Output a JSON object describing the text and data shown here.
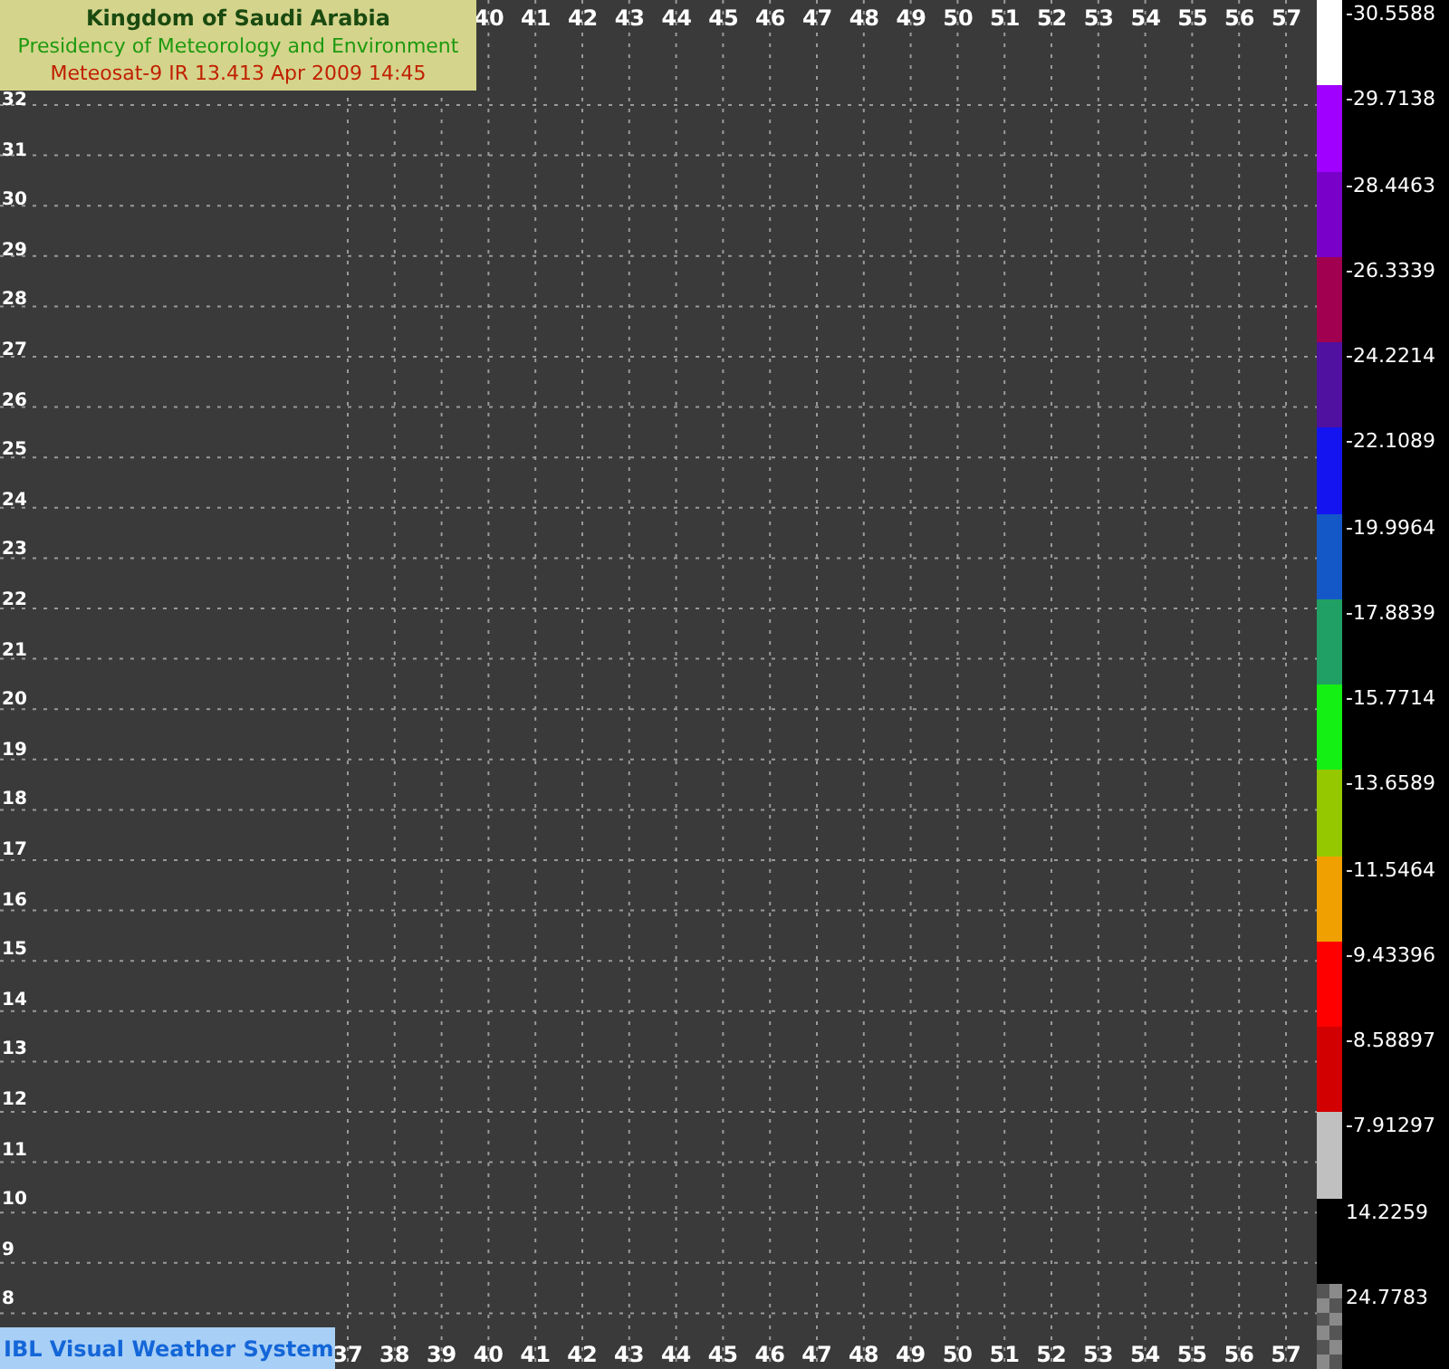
{
  "header": {
    "title": "Kingdom of Saudi Arabia",
    "subtitle": "Presidency of Meteorology and Environment",
    "product": "Meteosat-9 IR 13.413 Apr 2009 14:45"
  },
  "axes": {
    "top_ticks": [
      "40",
      "41",
      "42",
      "43",
      "44",
      "45",
      "46",
      "47",
      "48",
      "49",
      "50",
      "51",
      "52",
      "53",
      "54",
      "55",
      "56",
      "57"
    ],
    "bottom_ticks": [
      "37",
      "38",
      "39",
      "40",
      "41",
      "42",
      "43",
      "44",
      "45",
      "46",
      "47",
      "48",
      "49",
      "50",
      "51",
      "52",
      "53",
      "54",
      "55",
      "56",
      "57"
    ],
    "left_ticks": [
      "32",
      "31",
      "30",
      "29",
      "28",
      "27",
      "26",
      "25",
      "24",
      "23",
      "22",
      "21",
      "20",
      "19",
      "18",
      "17",
      "16",
      "15",
      "14",
      "13",
      "12",
      "11",
      "10",
      "9",
      "8"
    ]
  },
  "legend": [
    {
      "label": "-30.5588",
      "color": "#ffffff"
    },
    {
      "label": "-29.7138",
      "color": "#a000ff"
    },
    {
      "label": "-28.4463",
      "color": "#7800c8"
    },
    {
      "label": "-26.3339",
      "color": "#a0004f"
    },
    {
      "label": "-24.2214",
      "color": "#5010a0"
    },
    {
      "label": "-22.1089",
      "color": "#1414f0"
    },
    {
      "label": "-19.9964",
      "color": "#1458c8"
    },
    {
      "label": "-17.8839",
      "color": "#20a064"
    },
    {
      "label": "-15.7714",
      "color": "#14f014"
    },
    {
      "label": "-13.6589",
      "color": "#96c800"
    },
    {
      "label": "-11.5464",
      "color": "#f0a000"
    },
    {
      "label": "-9.43396",
      "color": "#ff0000"
    },
    {
      "label": "-8.58897",
      "color": "#d20000"
    },
    {
      "label": "-7.91297",
      "color": "#c0c0c0"
    },
    {
      "label": "14.2259",
      "color": "#000000"
    },
    {
      "label": "24.7783",
      "kind": "checker"
    }
  ],
  "footer": "IBL Visual Weather System"
}
